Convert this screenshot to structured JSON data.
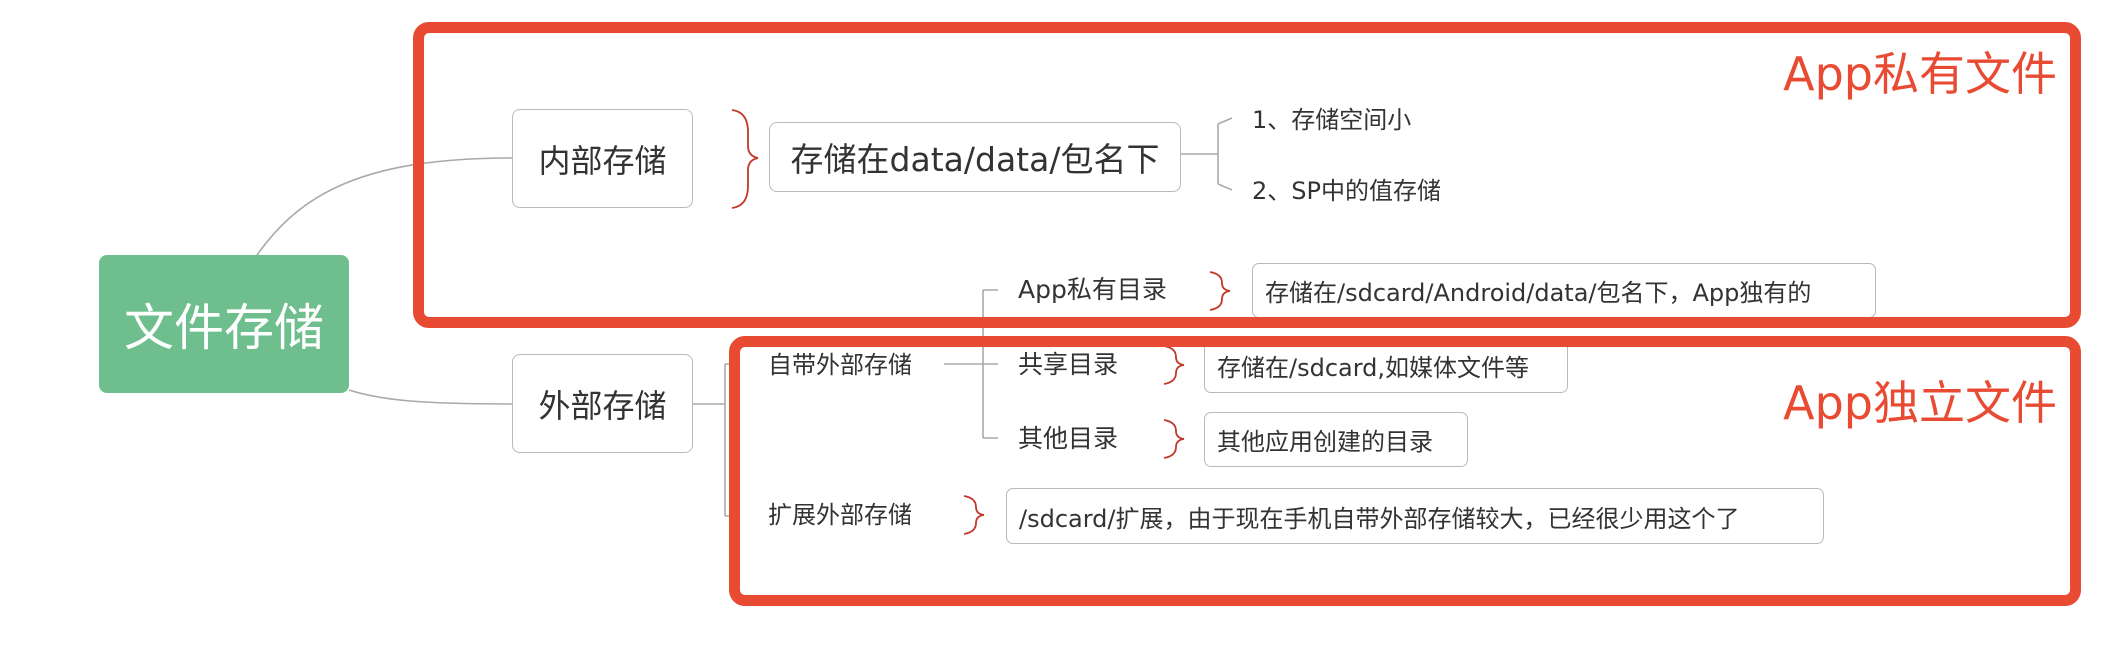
{
  "root": {
    "label": "文件存储",
    "color": "#6fbf8e"
  },
  "accent_color": "#e84a32",
  "groups": {
    "private": {
      "title": "App私有文件"
    },
    "independent": {
      "title": "App独立文件"
    }
  },
  "internal": {
    "label": "内部存储",
    "path": "存储在data/data/包名下",
    "notes": [
      "1、存储空间小",
      "2、SP中的值存储"
    ]
  },
  "external": {
    "label": "外部存储",
    "builtin": {
      "label": "自带外部存储",
      "dirs": [
        {
          "name": "App私有目录",
          "desc": "存储在/sdcard/Android/data/包名下，App独有的"
        },
        {
          "name": "共享目录",
          "desc": "存储在/sdcard,如媒体文件等"
        },
        {
          "name": "其他目录",
          "desc": "其他应用创建的目录"
        }
      ]
    },
    "expansion": {
      "label": "扩展外部存储",
      "desc": "/sdcard/扩展，由于现在手机自带外部存储较大，已经很少用这个了"
    }
  }
}
